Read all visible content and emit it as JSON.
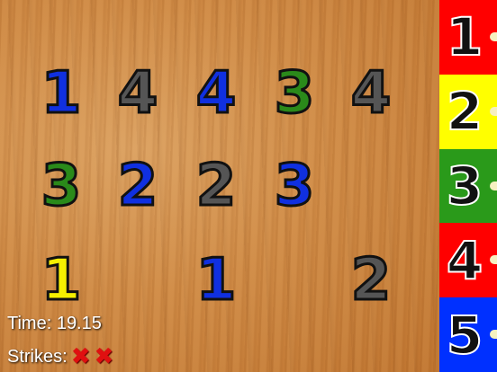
{
  "grid": [
    {
      "value": "1",
      "color": "#1030e0"
    },
    {
      "value": "4",
      "color": "#555555"
    },
    {
      "value": "4",
      "color": "#1030e0"
    },
    {
      "value": "3",
      "color": "#2a8a1a"
    },
    {
      "value": "4",
      "color": "#555555"
    },
    {
      "value": "3",
      "color": "#2a8a1a"
    },
    {
      "value": "2",
      "color": "#1030e0"
    },
    {
      "value": "2",
      "color": "#555555"
    },
    {
      "value": "3",
      "color": "#1030e0"
    },
    {
      "value": "1",
      "color": "#f5f000"
    },
    {
      "value": "1",
      "color": "#1030e0"
    },
    {
      "value": "2",
      "color": "#555555"
    }
  ],
  "palette": [
    {
      "label": "1",
      "color": "#ff0000"
    },
    {
      "label": "2",
      "color": "#ffff00"
    },
    {
      "label": "3",
      "color": "#2a9a1a"
    },
    {
      "label": "4",
      "color": "#ff0000"
    },
    {
      "label": "5",
      "color": "#0030ff"
    }
  ],
  "hud": {
    "time_label": "Time: 19.15",
    "strikes_label": "Strikes:",
    "strike_marks": [
      "✖",
      "✖"
    ]
  }
}
